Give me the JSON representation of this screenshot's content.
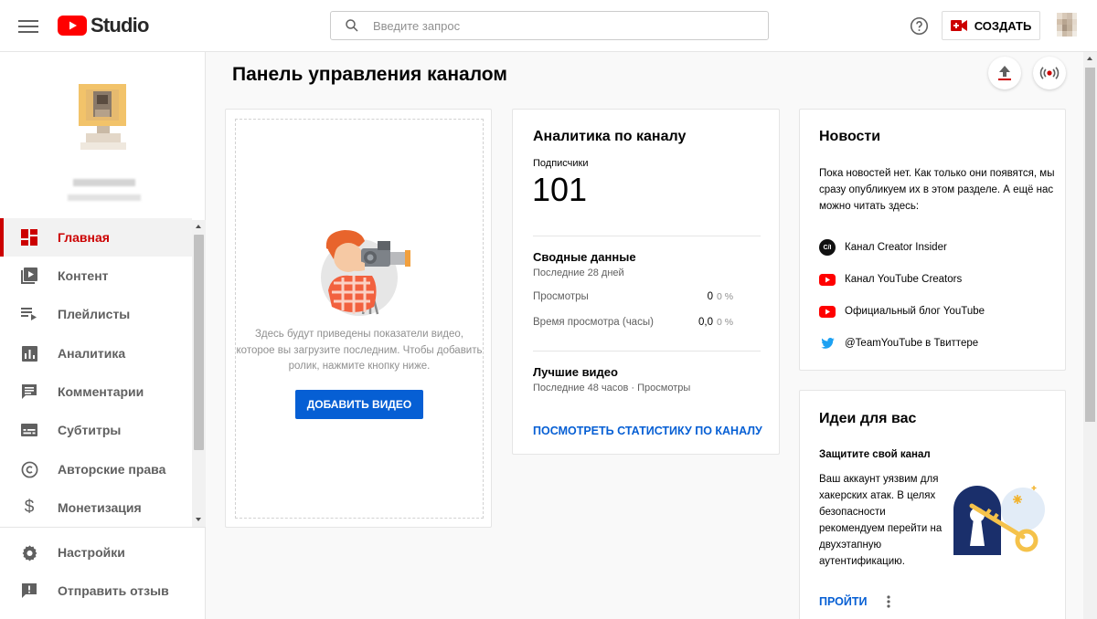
{
  "header": {
    "logo_text": "Studio",
    "search_placeholder": "Введите запрос",
    "create_label": "СОЗДАТЬ"
  },
  "sidebar": {
    "items": [
      {
        "label": "Главная",
        "icon": "dashboard-icon",
        "active": true
      },
      {
        "label": "Контент",
        "icon": "video-library-icon"
      },
      {
        "label": "Плейлисты",
        "icon": "playlist-icon"
      },
      {
        "label": "Аналитика",
        "icon": "bar-chart-icon"
      },
      {
        "label": "Комментарии",
        "icon": "comment-icon"
      },
      {
        "label": "Субтитры",
        "icon": "subtitles-icon"
      },
      {
        "label": "Авторские права",
        "icon": "copyright-icon"
      },
      {
        "label": "Монетизация",
        "icon": "dollar-icon"
      }
    ],
    "bottom_items": [
      {
        "label": "Настройки",
        "icon": "gear-icon"
      },
      {
        "label": "Отправить отзыв",
        "icon": "feedback-icon"
      }
    ]
  },
  "main": {
    "title": "Панель управления каналом"
  },
  "upload_card": {
    "text": "Здесь будут приведены показатели видео, которое вы загрузите последним. Чтобы добавить ролик, нажмите кнопку ниже.",
    "button_label": "ДОБАВИТЬ ВИДЕО"
  },
  "analytics_card": {
    "title": "Аналитика по каналу",
    "subscribers_label": "Подписчики",
    "subscribers_value": "101",
    "summary_title": "Сводные данные",
    "summary_period": "Последние 28 дней",
    "rows": [
      {
        "label": "Просмотры",
        "value": "0",
        "change": "0 %"
      },
      {
        "label": "Время просмотра (часы)",
        "value": "0,0",
        "change": "0 %"
      }
    ],
    "top_videos_title": "Лучшие видео",
    "top_videos_period": "Последние 48 часов · Просмотры",
    "link_label": "ПОСМОТРЕТЬ СТАТИСТИКУ ПО КАНАЛУ"
  },
  "news_card": {
    "title": "Новости",
    "text": "Пока новостей нет. Как только они появятся, мы сразу опубликуем их в этом разделе. А ещё нас можно читать здесь:",
    "links": [
      {
        "label": "Канал Creator Insider",
        "icon": "creator-insider-icon",
        "badge": "C/I"
      },
      {
        "label": "Канал YouTube Creators",
        "icon": "youtube-icon"
      },
      {
        "label": "Официальный блог YouTube",
        "icon": "youtube-icon"
      },
      {
        "label": "@TeamYouTube в Твиттере",
        "icon": "twitter-icon"
      }
    ]
  },
  "ideas_card": {
    "title": "Идеи для вас",
    "subtitle": "Защитите свой канал",
    "text": "Ваш аккаунт уязвим для хакерских атак. В целях безопасности рекомендуем перейти на двухэтапную аутентификацию.",
    "link_label": "ПРОЙТИ"
  },
  "colors": {
    "brand_red": "#ff0000",
    "active_red": "#cc0000",
    "link_blue": "#065fd4"
  }
}
